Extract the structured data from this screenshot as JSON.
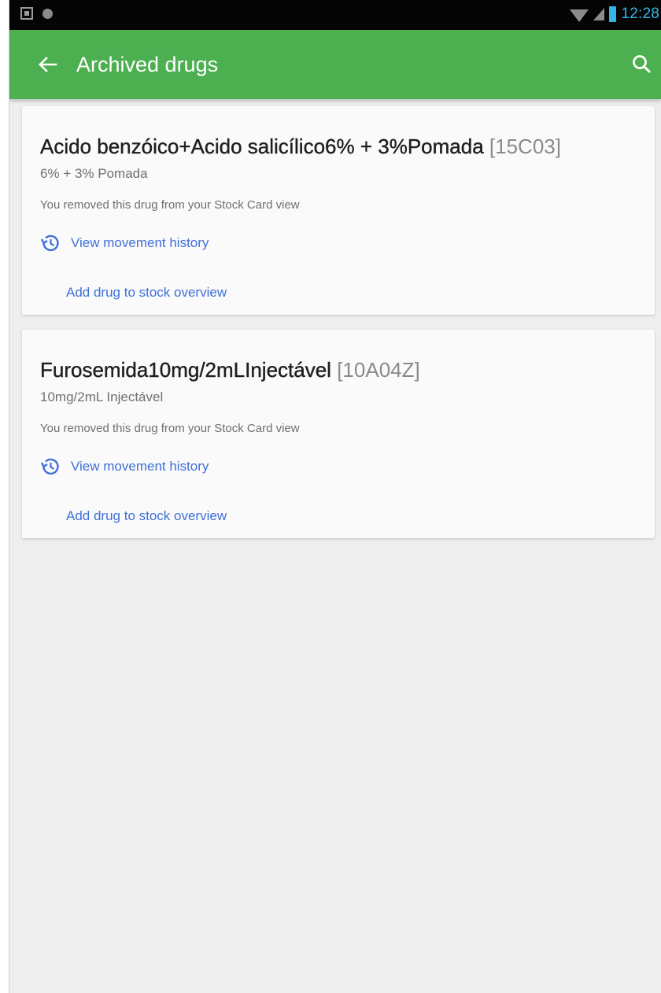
{
  "status_bar": {
    "time": "12:28",
    "icons": [
      "notification-icon",
      "globe-icon",
      "wifi-icon",
      "signal-icon",
      "battery-icon"
    ],
    "time_color": "#33b5e5"
  },
  "app_bar": {
    "title": "Archived drugs",
    "color": "#4caf50",
    "back_icon": "arrow-back-icon",
    "search_icon": "search-icon"
  },
  "drugs": [
    {
      "name": "Acido benzóico+Acido salicílico6% + 3%Pomada",
      "code": "[15C03]",
      "subtitle": "6% + 3% Pomada",
      "note": "You removed this drug from your Stock Card view",
      "history_label": "View movement history",
      "add_label": "Add drug to stock overview"
    },
    {
      "name": "Furosemida10mg/2mLInjectável",
      "code": "[10A04Z]",
      "subtitle": "10mg/2mL Injectável",
      "note": "You removed this drug from your Stock Card view",
      "history_label": "View movement history",
      "add_label": "Add drug to stock overview"
    }
  ],
  "link_color": "#3f6fd8"
}
